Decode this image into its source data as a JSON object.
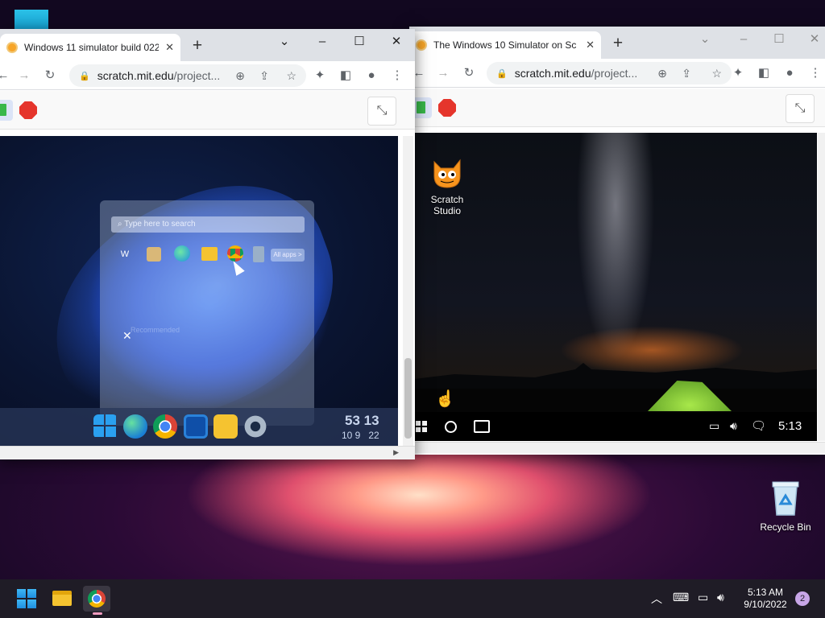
{
  "desktop": {
    "recycle_bin_label": "Recycle Bin"
  },
  "colors": {
    "win10_accent": "#3bb34a",
    "chrome_frame": "#dee1e6",
    "stop_red": "#e5352c"
  },
  "left_window": {
    "tab_title": "Windows 11 simulator build 022",
    "url_host": "scratch.mit.edu",
    "url_path": "/project...",
    "sim": {
      "search_placeholder": "Type here to search",
      "all_apps": "All apps >",
      "clock_time": "53 13",
      "clock_date": "10 9   22",
      "blurred_label": "Recommended",
      "word_icon_letter": "W"
    }
  },
  "right_window": {
    "tab_title": "The Windows 10 Simulator on Sc",
    "url_host": "scratch.mit.edu",
    "url_path": "/project...",
    "sim": {
      "desktop_icon_label": "Scratch Studio",
      "clock": "5:13"
    }
  },
  "taskbar": {
    "time": "5:13 AM",
    "date": "9/10/2022",
    "notification_count": "2"
  }
}
